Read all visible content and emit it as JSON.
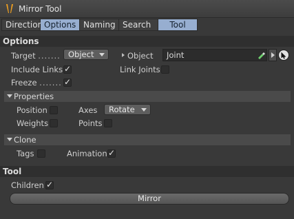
{
  "window": {
    "title": "Mirror Tool"
  },
  "tabs": [
    {
      "label": "Direction",
      "active": false
    },
    {
      "label": "Options",
      "active": true
    },
    {
      "label": "Naming",
      "active": false
    },
    {
      "label": "Search",
      "active": false
    },
    {
      "label": "Tool",
      "active": true
    }
  ],
  "options": {
    "header": "Options",
    "target_label": "Target",
    "target_dots": ".......",
    "target_value": "Object",
    "object_label": "Object",
    "object_value": "Joint",
    "include_links_label": "Include Links",
    "include_links_checked": true,
    "link_joints_label": "Link Joints",
    "link_joints_checked": false,
    "freeze_label": "Freeze",
    "freeze_dots": ".......",
    "freeze_checked": true
  },
  "properties": {
    "header": "Properties",
    "position_label": "Position",
    "position_checked": false,
    "axes_label": "Axes",
    "axes_value": "Rotate",
    "weights_label": "Weights",
    "weights_checked": false,
    "points_label": "Points",
    "points_checked": false
  },
  "clone": {
    "header": "Clone",
    "tags_label": "Tags",
    "tags_checked": false,
    "animation_label": "Animation",
    "animation_checked": true
  },
  "tool": {
    "header": "Tool",
    "children_label": "Children",
    "children_checked": true,
    "mirror_button": "Mirror"
  },
  "colors": {
    "background": "#393939",
    "tab_active": "#97aed0",
    "section_header": "#2f2f2f",
    "sub_header": "#4a4a4a",
    "pick_icon": "#6fcf6f"
  },
  "icons": {
    "logo": "mirror-tool-logo",
    "pick": "pick-object-icon",
    "arrow": "play-arrow-icon",
    "cursor": "cursor-icon"
  }
}
